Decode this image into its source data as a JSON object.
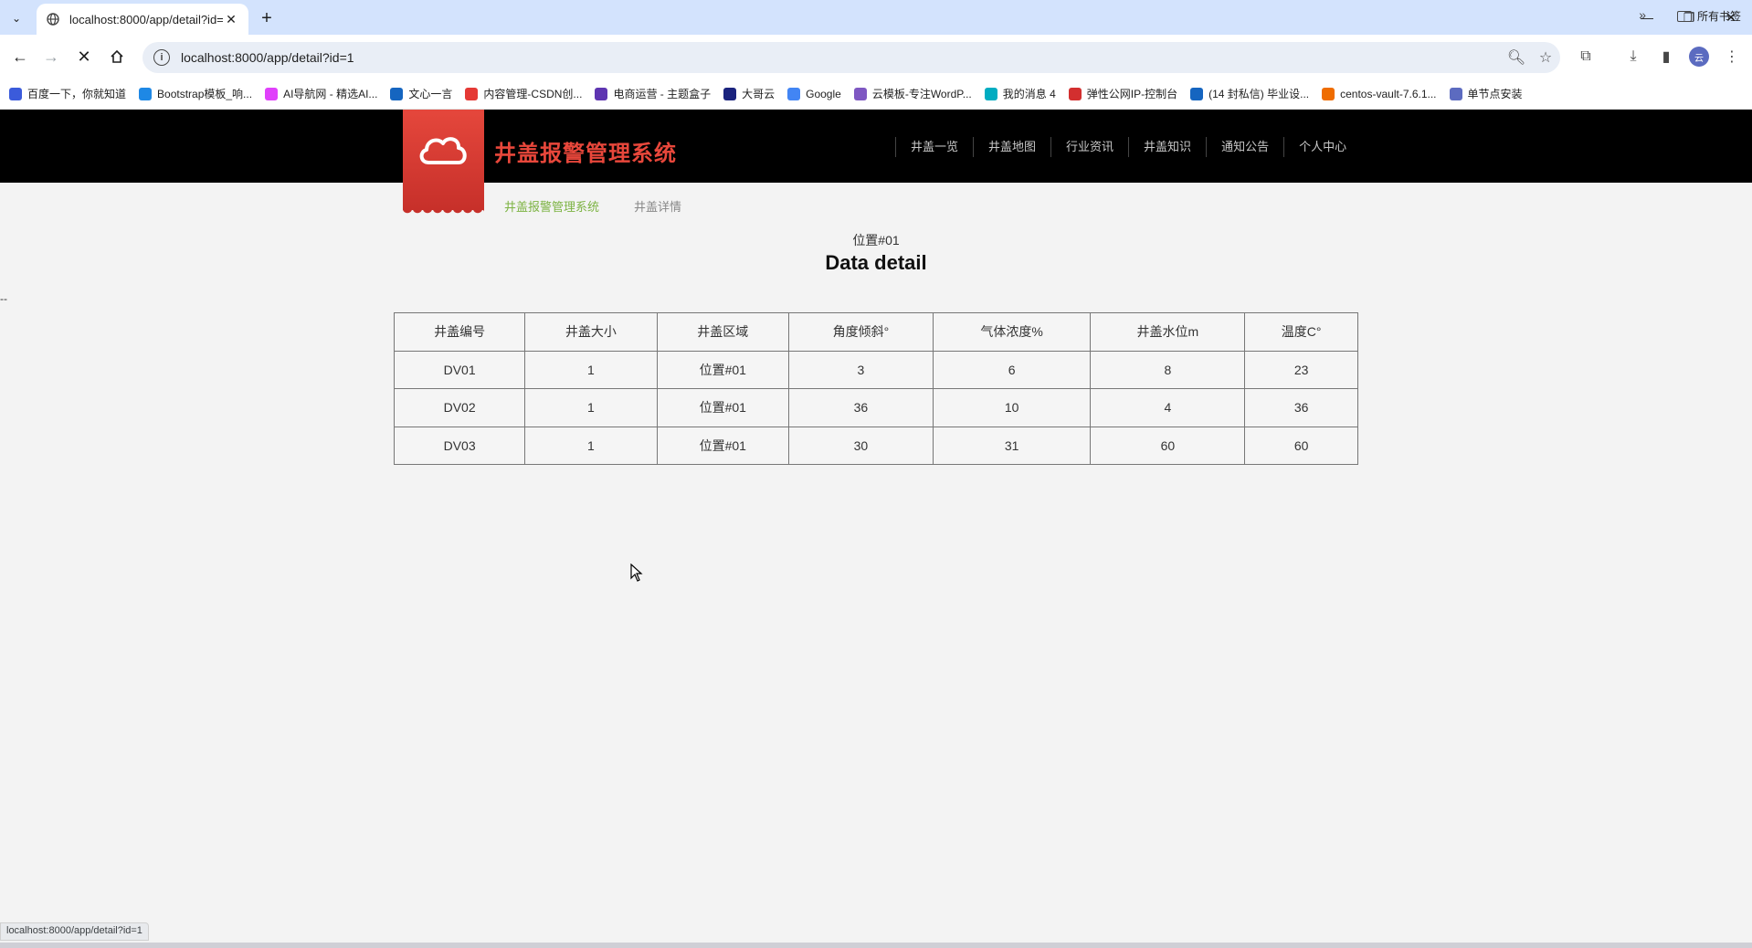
{
  "browser": {
    "tab_title": "localhost:8000/app/detail?id=1",
    "url": "localhost:8000/app/detail?id=1",
    "bookmarks": [
      {
        "label": "百度一下，你就知道",
        "color": "#3b5bdb"
      },
      {
        "label": "Bootstrap模板_响...",
        "color": "#1e88e5"
      },
      {
        "label": "AI导航网 - 精选AI...",
        "color": "#e040fb"
      },
      {
        "label": "文心一言",
        "color": "#1565c0"
      },
      {
        "label": "内容管理-CSDN创...",
        "color": "#e53935"
      },
      {
        "label": "电商运营 - 主题盒子",
        "color": "#5e35b1"
      },
      {
        "label": "大哥云",
        "color": "#1a237e"
      },
      {
        "label": "Google",
        "color": "#4285f4"
      },
      {
        "label": "云模板-专注WordP...",
        "color": "#7e57c2"
      },
      {
        "label": "我的消息 4",
        "color": "#00acc1"
      },
      {
        "label": "弹性公网IP-控制台",
        "color": "#d32f2f"
      },
      {
        "label": "(14 封私信) 毕业设...",
        "color": "#1565c0"
      },
      {
        "label": "centos-vault-7.6.1...",
        "color": "#ef6c00"
      },
      {
        "label": "单节点安装",
        "color": "#5c6bc0"
      }
    ],
    "all_bookmarks_label": "所有书签",
    "status_url": "localhost:8000/app/detail?id=1"
  },
  "site": {
    "title": "井盖报警管理系统",
    "nav": [
      "井盖一览",
      "井盖地图",
      "行业资讯",
      "井盖知识",
      "通知公告",
      "个人中心"
    ],
    "breadcrumb_home": "井盖报警管理系统",
    "breadcrumb_current": "井盖详情",
    "location": "位置#01",
    "heading": "Data detail",
    "stray_text": "--",
    "brand_color": "#e8473b"
  },
  "table": {
    "headers": [
      "井盖编号",
      "井盖大小",
      "井盖区域",
      "角度倾斜°",
      "气体浓度%",
      "井盖水位m",
      "温度C°"
    ],
    "rows": [
      [
        "DV01",
        "1",
        "位置#01",
        "3",
        "6",
        "8",
        "23"
      ],
      [
        "DV02",
        "1",
        "位置#01",
        "36",
        "10",
        "4",
        "36"
      ],
      [
        "DV03",
        "1",
        "位置#01",
        "30",
        "31",
        "60",
        "60"
      ]
    ]
  }
}
